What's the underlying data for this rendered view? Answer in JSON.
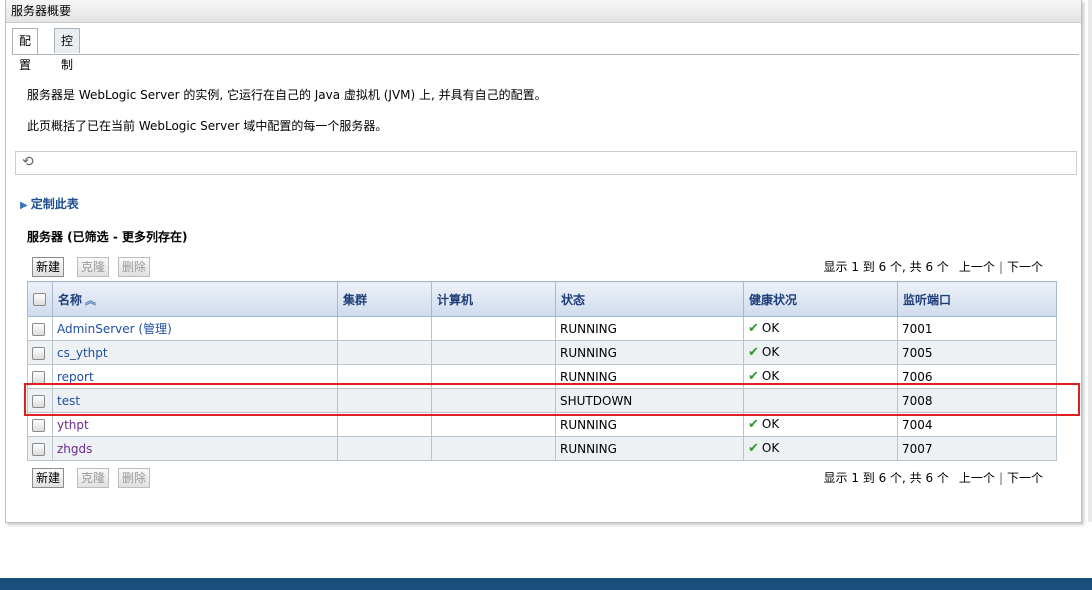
{
  "panel": {
    "title": "服务器概要"
  },
  "tabs": [
    {
      "label": "配置",
      "active": true
    },
    {
      "label": "控制",
      "active": false
    }
  ],
  "description": {
    "line1": "服务器是 WebLogic Server 的实例, 它运行在自己的 Java 虚拟机 (JVM) 上, 并具有自己的配置。",
    "line2": "此页概括了已在当前 WebLogic Server 域中配置的每一个服务器。"
  },
  "refresh_icon": "refresh-icon",
  "customize": {
    "label": "定制此表",
    "icon": "expand-triangle-icon"
  },
  "section_title": "服务器 (已筛选 - 更多列存在)",
  "toolbar": {
    "new_label": "新建",
    "clone_label": "克隆",
    "delete_label": "删除"
  },
  "pager": {
    "summary": "显示 1 到 6 个, 共 6 个",
    "prev": "上一个",
    "separator": "|",
    "next": "下一个"
  },
  "table": {
    "headers": {
      "name": "名称",
      "cluster": "集群",
      "machine": "计算机",
      "state": "状态",
      "health": "健康状况",
      "port": "监听端口"
    },
    "sort_icon": "sort-ascending-icon",
    "rows": [
      {
        "name": "AdminServer (管理)",
        "cluster": "",
        "machine": "",
        "state": "RUNNING",
        "health": "OK",
        "port": "7001"
      },
      {
        "name": "cs_ythpt",
        "cluster": "",
        "machine": "",
        "state": "RUNNING",
        "health": "OK",
        "port": "7005"
      },
      {
        "name": "report",
        "cluster": "",
        "machine": "",
        "state": "RUNNING",
        "health": "OK",
        "port": "7006"
      },
      {
        "name": "test",
        "cluster": "",
        "machine": "",
        "state": "SHUTDOWN",
        "health": "",
        "port": "7008"
      },
      {
        "name": "ythpt",
        "cluster": "",
        "machine": "",
        "state": "RUNNING",
        "health": "OK",
        "port": "7004"
      },
      {
        "name": "zhgds",
        "cluster": "",
        "machine": "",
        "state": "RUNNING",
        "health": "OK",
        "port": "7007"
      }
    ]
  },
  "colors": {
    "link": "#1f4fa0",
    "visited_link": "#6a2a8a",
    "header_text": "#1f3f7a",
    "highlight_border": "#e02020",
    "footer_bar": "#1a4f7c",
    "ok_check": "#2f9a2f"
  }
}
